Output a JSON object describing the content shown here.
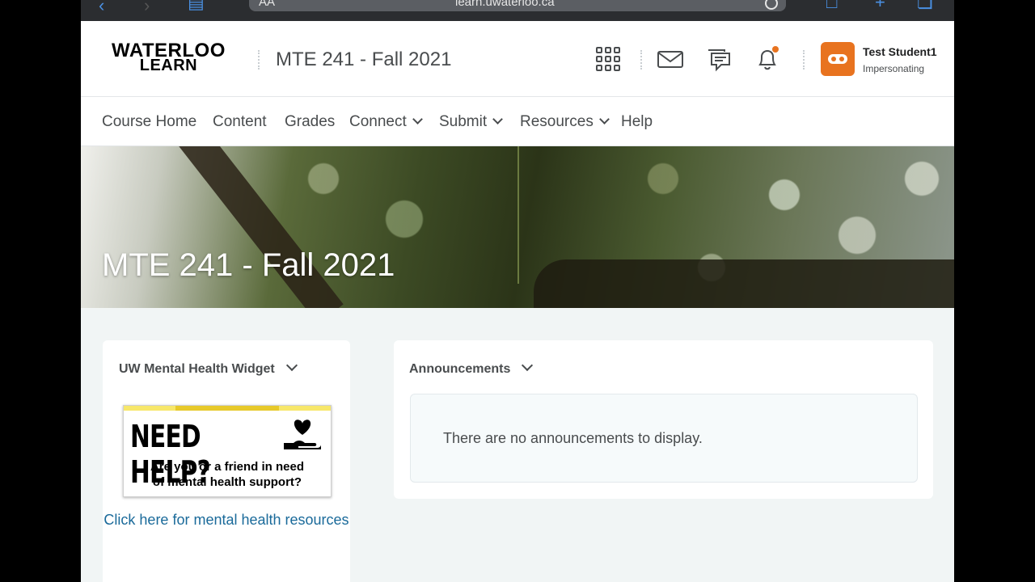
{
  "browser": {
    "text_size_label": "AA",
    "address": "learn.uwaterloo.ca"
  },
  "header": {
    "logo_line1": "WATERLOO",
    "logo_line2": "LEARN",
    "course_title": "MTE 241 - Fall 2021",
    "icons": [
      "apps-grid-icon",
      "mail-icon",
      "chat-icon",
      "bell-icon"
    ],
    "user_name": "Test Student1",
    "user_status": "Impersonating",
    "avatar_color": "#e8731f",
    "notification_color": "#e8731f"
  },
  "nav": {
    "items": [
      {
        "label": "Course Home",
        "dropdown": false
      },
      {
        "label": "Content",
        "dropdown": false
      },
      {
        "label": "Grades",
        "dropdown": false
      },
      {
        "label": "Connect",
        "dropdown": true
      },
      {
        "label": "Submit",
        "dropdown": true
      },
      {
        "label": "Resources",
        "dropdown": true
      },
      {
        "label": "Help",
        "dropdown": false
      }
    ]
  },
  "banner": {
    "title": "MTE 241 - Fall 2021"
  },
  "widgets": {
    "mental_health": {
      "title": "UW Mental Health Widget",
      "image_headline": "NEED HELP?",
      "image_line1": "Are you or a friend in need",
      "image_line2": "of mental health support?",
      "link_text": "Click here for mental health resources"
    },
    "announcements": {
      "title": "Announcements",
      "empty_message": "There are no announcements to display."
    }
  },
  "colors": {
    "link": "#1a6a9a",
    "text": "#494c4e",
    "page_bg": "#f1f5f5"
  }
}
